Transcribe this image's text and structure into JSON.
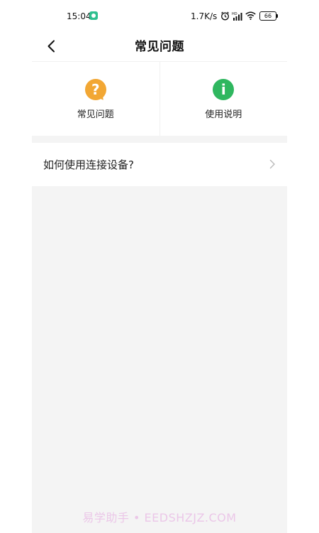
{
  "status_bar": {
    "time": "15:04",
    "network_speed": "1.7K/s",
    "battery_level": "66",
    "icons": [
      "app-badge-icon",
      "alarm-icon",
      "hd-signal-icon",
      "wifi-icon",
      "battery-icon"
    ]
  },
  "header": {
    "title": "常见问题",
    "back_icon": "chevron-left-icon"
  },
  "categories": [
    {
      "label": "常见问题",
      "icon": "question-icon",
      "icon_glyph": "?",
      "color": "#f2a734"
    },
    {
      "label": "使用说明",
      "icon": "info-icon",
      "icon_glyph": "i",
      "color": "#2fb75f"
    }
  ],
  "list": {
    "items": [
      {
        "label": "如何使用连接设备?",
        "icon": "chevron-right-icon"
      }
    ]
  },
  "watermark": "易学助手 • EEDSHZJZ.COM"
}
